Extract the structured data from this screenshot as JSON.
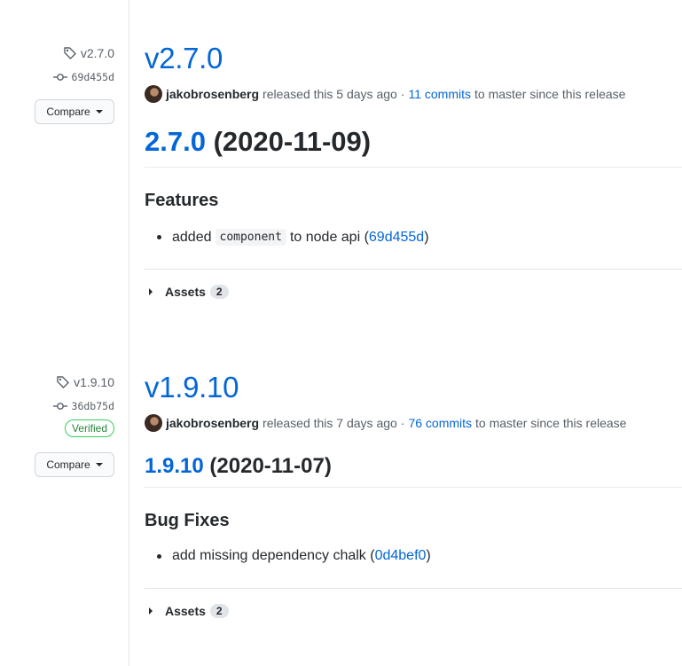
{
  "releases": [
    {
      "tag": "v2.7.0",
      "commit": "69d455d",
      "verified": "",
      "compare_label": "Compare",
      "title": "v2.7.0",
      "author": "jakobrosenberg",
      "released_text": "released this 5 days ago",
      "separator": "·",
      "commits_link": "11 commits",
      "commits_suffix": "to master since this release",
      "version_link": "2.7.0",
      "version_date": "(2020-11-09)",
      "section": "Features",
      "bullet_prefix": "added",
      "bullet_code": "component",
      "bullet_mid": "to node api (",
      "bullet_link": "69d455d",
      "bullet_end": ")",
      "assets_label": "Assets",
      "assets_count": "2"
    },
    {
      "tag": "v1.9.10",
      "commit": "36db75d",
      "verified": "Verified",
      "compare_label": "Compare",
      "title": "v1.9.10",
      "author": "jakobrosenberg",
      "released_text": "released this 7 days ago",
      "separator": "·",
      "commits_link": "76 commits",
      "commits_suffix": "to master since this release",
      "version_link": "1.9.10",
      "version_date": "(2020-11-07)",
      "section": "Bug Fixes",
      "bullet_prefix": "add missing dependency chalk (",
      "bullet_link": "0d4bef0",
      "bullet_end": ")",
      "assets_label": "Assets",
      "assets_count": "2"
    }
  ],
  "colors": {
    "link": "#0366d6",
    "verified": "#22863a",
    "text": "#24292e",
    "muted": "#586069"
  },
  "icons": {
    "tag": "tag-icon",
    "commit": "git-commit-icon",
    "avatar": "avatar",
    "caret": "caret-down-icon",
    "expand": "triangle-right-icon"
  }
}
